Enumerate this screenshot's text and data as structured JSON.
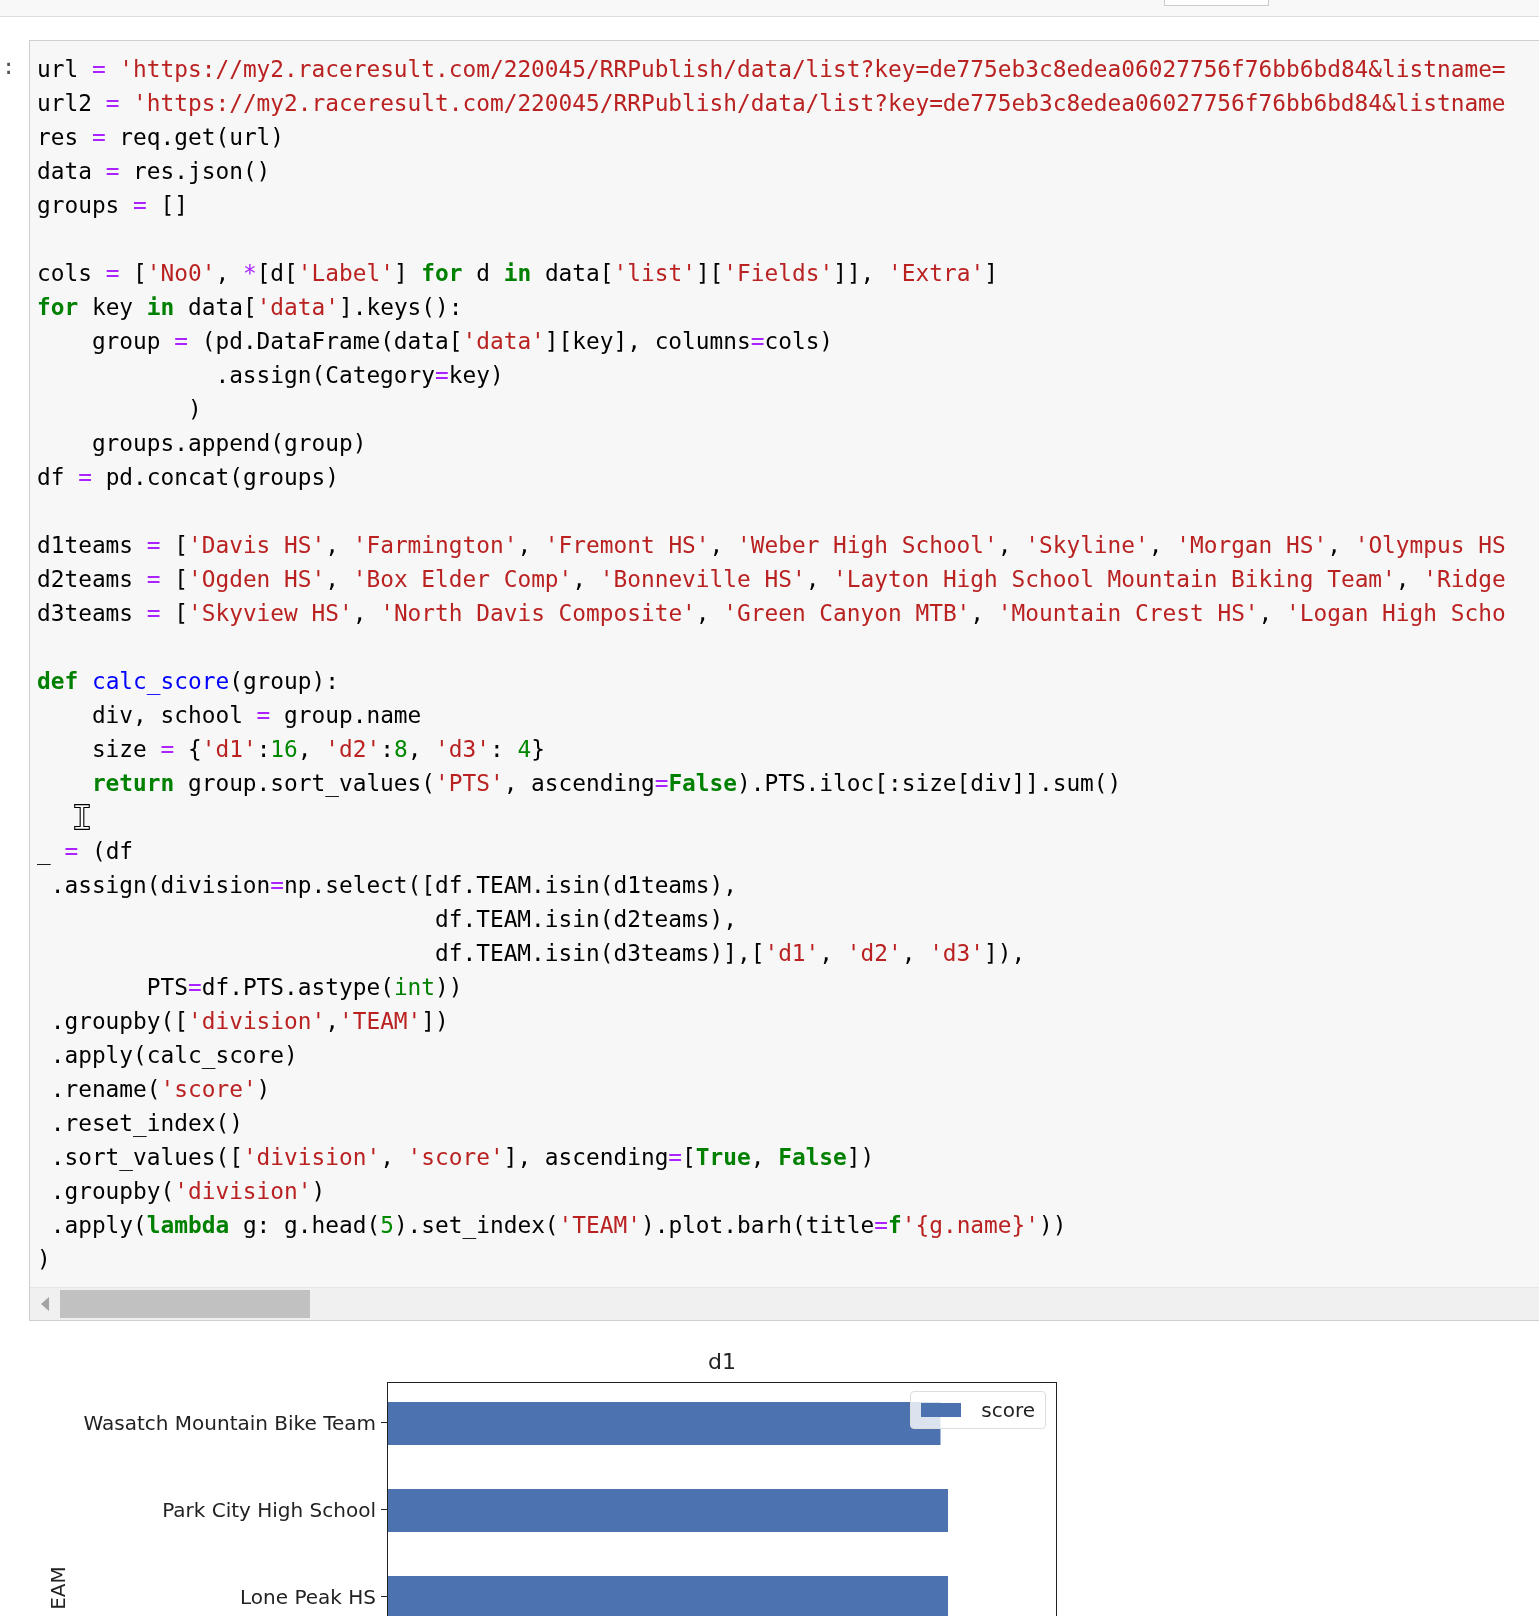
{
  "cell": {
    "prompt": ":",
    "blocks": [
      [
        [
          {
            "kind": "p",
            "text": "url "
          },
          {
            "kind": "o",
            "text": "="
          },
          {
            "kind": "s",
            "text": " 'https://my2.raceresult.com/220045/RRPublish/data/list?key=de775eb3c8edea06027756f76bb6bd84&listname="
          }
        ],
        [
          {
            "kind": "p",
            "text": "url2 "
          },
          {
            "kind": "o",
            "text": "="
          },
          {
            "kind": "s",
            "text": " 'https://my2.raceresult.com/220045/RRPublish/data/list?key=de775eb3c8edea06027756f76bb6bd84&listname"
          }
        ],
        [
          {
            "kind": "p",
            "text": "res "
          },
          {
            "kind": "o",
            "text": "="
          },
          {
            "kind": "p",
            "text": " req.get(url)"
          }
        ],
        [
          {
            "kind": "p",
            "text": "data "
          },
          {
            "kind": "o",
            "text": "="
          },
          {
            "kind": "p",
            "text": " res.json()"
          }
        ],
        [
          {
            "kind": "p",
            "text": "groups "
          },
          {
            "kind": "o",
            "text": "="
          },
          {
            "kind": "p",
            "text": " []"
          }
        ]
      ],
      [
        [
          {
            "kind": "p",
            "text": "cols "
          },
          {
            "kind": "o",
            "text": "="
          },
          {
            "kind": "p",
            "text": " ["
          },
          {
            "kind": "s",
            "text": "'No0'"
          },
          {
            "kind": "p",
            "text": ", "
          },
          {
            "kind": "o",
            "text": "*"
          },
          {
            "kind": "p",
            "text": "[d["
          },
          {
            "kind": "s",
            "text": "'Label'"
          },
          {
            "kind": "p",
            "text": "] "
          },
          {
            "kind": "k",
            "text": "for"
          },
          {
            "kind": "p",
            "text": " d "
          },
          {
            "kind": "k",
            "text": "in"
          },
          {
            "kind": "p",
            "text": " data["
          },
          {
            "kind": "s",
            "text": "'list'"
          },
          {
            "kind": "p",
            "text": "]["
          },
          {
            "kind": "s",
            "text": "'Fields'"
          },
          {
            "kind": "p",
            "text": "]], "
          },
          {
            "kind": "s",
            "text": "'Extra'"
          },
          {
            "kind": "p",
            "text": "]"
          }
        ],
        [
          {
            "kind": "k",
            "text": "for"
          },
          {
            "kind": "p",
            "text": " key "
          },
          {
            "kind": "k",
            "text": "in"
          },
          {
            "kind": "p",
            "text": " data["
          },
          {
            "kind": "s",
            "text": "'data'"
          },
          {
            "kind": "p",
            "text": "].keys():"
          }
        ],
        [
          {
            "kind": "p",
            "text": "    group "
          },
          {
            "kind": "o",
            "text": "="
          },
          {
            "kind": "p",
            "text": " (pd.DataFrame(data["
          },
          {
            "kind": "s",
            "text": "'data'"
          },
          {
            "kind": "p",
            "text": "][key], columns"
          },
          {
            "kind": "o",
            "text": "="
          },
          {
            "kind": "p",
            "text": "cols)"
          }
        ],
        [
          {
            "kind": "p",
            "text": "             .assign(Category"
          },
          {
            "kind": "o",
            "text": "="
          },
          {
            "kind": "p",
            "text": "key)"
          }
        ],
        [
          {
            "kind": "p",
            "text": "           )"
          }
        ],
        [
          {
            "kind": "p",
            "text": "    groups.append(group)"
          }
        ],
        [
          {
            "kind": "p",
            "text": "df "
          },
          {
            "kind": "o",
            "text": "="
          },
          {
            "kind": "p",
            "text": " pd.concat(groups)"
          }
        ]
      ],
      [
        [
          {
            "kind": "p",
            "text": "d1teams "
          },
          {
            "kind": "o",
            "text": "="
          },
          {
            "kind": "p",
            "text": " ["
          },
          {
            "kind": "s",
            "text": "'Davis HS'"
          },
          {
            "kind": "p",
            "text": ", "
          },
          {
            "kind": "s",
            "text": "'Farmington'"
          },
          {
            "kind": "p",
            "text": ", "
          },
          {
            "kind": "s",
            "text": "'Fremont HS'"
          },
          {
            "kind": "p",
            "text": ", "
          },
          {
            "kind": "s",
            "text": "'Weber High School'"
          },
          {
            "kind": "p",
            "text": ", "
          },
          {
            "kind": "s",
            "text": "'Skyline'"
          },
          {
            "kind": "p",
            "text": ", "
          },
          {
            "kind": "s",
            "text": "'Morgan HS'"
          },
          {
            "kind": "p",
            "text": ", "
          },
          {
            "kind": "s",
            "text": "'Olympus HS"
          }
        ],
        [
          {
            "kind": "p",
            "text": "d2teams "
          },
          {
            "kind": "o",
            "text": "="
          },
          {
            "kind": "p",
            "text": " ["
          },
          {
            "kind": "s",
            "text": "'Ogden HS'"
          },
          {
            "kind": "p",
            "text": ", "
          },
          {
            "kind": "s",
            "text": "'Box Elder Comp'"
          },
          {
            "kind": "p",
            "text": ", "
          },
          {
            "kind": "s",
            "text": "'Bonneville HS'"
          },
          {
            "kind": "p",
            "text": ", "
          },
          {
            "kind": "s",
            "text": "'Layton High School Mountain Biking Team'"
          },
          {
            "kind": "p",
            "text": ", "
          },
          {
            "kind": "s",
            "text": "'Ridge"
          }
        ],
        [
          {
            "kind": "p",
            "text": "d3teams "
          },
          {
            "kind": "o",
            "text": "="
          },
          {
            "kind": "p",
            "text": " ["
          },
          {
            "kind": "s",
            "text": "'Skyview HS'"
          },
          {
            "kind": "p",
            "text": ", "
          },
          {
            "kind": "s",
            "text": "'North Davis Composite'"
          },
          {
            "kind": "p",
            "text": ", "
          },
          {
            "kind": "s",
            "text": "'Green Canyon MTB'"
          },
          {
            "kind": "p",
            "text": ", "
          },
          {
            "kind": "s",
            "text": "'Mountain Crest HS'"
          },
          {
            "kind": "p",
            "text": ", "
          },
          {
            "kind": "s",
            "text": "'Logan High Scho"
          }
        ]
      ],
      [
        [
          {
            "kind": "k",
            "text": "def "
          },
          {
            "kind": "f",
            "text": "calc_score"
          },
          {
            "kind": "p",
            "text": "(group):"
          }
        ],
        [
          {
            "kind": "p",
            "text": "    div, school "
          },
          {
            "kind": "o",
            "text": "="
          },
          {
            "kind": "p",
            "text": " group.name"
          }
        ],
        [
          {
            "kind": "p",
            "text": "    size "
          },
          {
            "kind": "o",
            "text": "="
          },
          {
            "kind": "p",
            "text": " {"
          },
          {
            "kind": "s",
            "text": "'d1'"
          },
          {
            "kind": "p",
            "text": ":"
          },
          {
            "kind": "n",
            "text": "16"
          },
          {
            "kind": "p",
            "text": ", "
          },
          {
            "kind": "s",
            "text": "'d2'"
          },
          {
            "kind": "p",
            "text": ":"
          },
          {
            "kind": "n",
            "text": "8"
          },
          {
            "kind": "p",
            "text": ", "
          },
          {
            "kind": "s",
            "text": "'d3'"
          },
          {
            "kind": "p",
            "text": ": "
          },
          {
            "kind": "n",
            "text": "4"
          },
          {
            "kind": "p",
            "text": "}"
          }
        ],
        [
          {
            "kind": "k",
            "text": "    return"
          },
          {
            "kind": "p",
            "text": " group.sort_values("
          },
          {
            "kind": "s",
            "text": "'PTS'"
          },
          {
            "kind": "p",
            "text": ", ascending"
          },
          {
            "kind": "o",
            "text": "="
          },
          {
            "kind": "k",
            "text": "False"
          },
          {
            "kind": "p",
            "text": ").PTS.iloc[:size[div]].sum()"
          }
        ]
      ],
      [
        [
          {
            "kind": "p",
            "text": "_ "
          },
          {
            "kind": "o",
            "text": "="
          },
          {
            "kind": "p",
            "text": " (df"
          }
        ],
        [
          {
            "kind": "p",
            "text": " .assign(division"
          },
          {
            "kind": "o",
            "text": "="
          },
          {
            "kind": "p",
            "text": "np.select([df.TEAM.isin(d1teams),"
          }
        ],
        [
          {
            "kind": "p",
            "text": "                             df.TEAM.isin(d2teams),"
          }
        ],
        [
          {
            "kind": "p",
            "text": "                             df.TEAM.isin(d3teams)],["
          },
          {
            "kind": "s",
            "text": "'d1'"
          },
          {
            "kind": "p",
            "text": ", "
          },
          {
            "kind": "s",
            "text": "'d2'"
          },
          {
            "kind": "p",
            "text": ", "
          },
          {
            "kind": "s",
            "text": "'d3'"
          },
          {
            "kind": "p",
            "text": "]),"
          }
        ],
        [
          {
            "kind": "p",
            "text": "        PTS"
          },
          {
            "kind": "o",
            "text": "="
          },
          {
            "kind": "p",
            "text": "df.PTS.astype("
          },
          {
            "kind": "b",
            "text": "int"
          },
          {
            "kind": "p",
            "text": "))"
          }
        ],
        [
          {
            "kind": "p",
            "text": " .groupby(["
          },
          {
            "kind": "s",
            "text": "'division'"
          },
          {
            "kind": "p",
            "text": ","
          },
          {
            "kind": "s",
            "text": "'TEAM'"
          },
          {
            "kind": "p",
            "text": "])"
          }
        ],
        [
          {
            "kind": "p",
            "text": " .apply(calc_score)"
          }
        ],
        [
          {
            "kind": "p",
            "text": " .rename("
          },
          {
            "kind": "s",
            "text": "'score'"
          },
          {
            "kind": "p",
            "text": ")"
          }
        ],
        [
          {
            "kind": "p",
            "text": " .reset_index()"
          }
        ],
        [
          {
            "kind": "p",
            "text": " .sort_values(["
          },
          {
            "kind": "s",
            "text": "'division'"
          },
          {
            "kind": "p",
            "text": ", "
          },
          {
            "kind": "s",
            "text": "'score'"
          },
          {
            "kind": "p",
            "text": "], ascending"
          },
          {
            "kind": "o",
            "text": "="
          },
          {
            "kind": "p",
            "text": "["
          },
          {
            "kind": "k",
            "text": "True"
          },
          {
            "kind": "p",
            "text": ", "
          },
          {
            "kind": "k",
            "text": "False"
          },
          {
            "kind": "p",
            "text": "])"
          }
        ],
        [
          {
            "kind": "p",
            "text": " .groupby("
          },
          {
            "kind": "s",
            "text": "'division'"
          },
          {
            "kind": "p",
            "text": ")"
          }
        ],
        [
          {
            "kind": "p",
            "text": " .apply("
          },
          {
            "kind": "k",
            "text": "lambda"
          },
          {
            "kind": "p",
            "text": " g: g.head("
          },
          {
            "kind": "n",
            "text": "5"
          },
          {
            "kind": "p",
            "text": ").set_index("
          },
          {
            "kind": "s",
            "text": "'TEAM'"
          },
          {
            "kind": "p",
            "text": ").plot.barh(title"
          },
          {
            "kind": "o",
            "text": "="
          },
          {
            "kind": "k",
            "text": "f"
          },
          {
            "kind": "s",
            "text": "'{g.name}'"
          },
          {
            "kind": "p",
            "text": "))"
          }
        ],
        [
          {
            "kind": "p",
            "text": ")"
          }
        ]
      ]
    ]
  },
  "chart": {
    "title": "d1",
    "ylabel": "EAM",
    "legend": "score",
    "categories": [
      "Wasatch Mountain Bike Team",
      "Park City High School",
      "Lone Peak HS"
    ]
  }
}
